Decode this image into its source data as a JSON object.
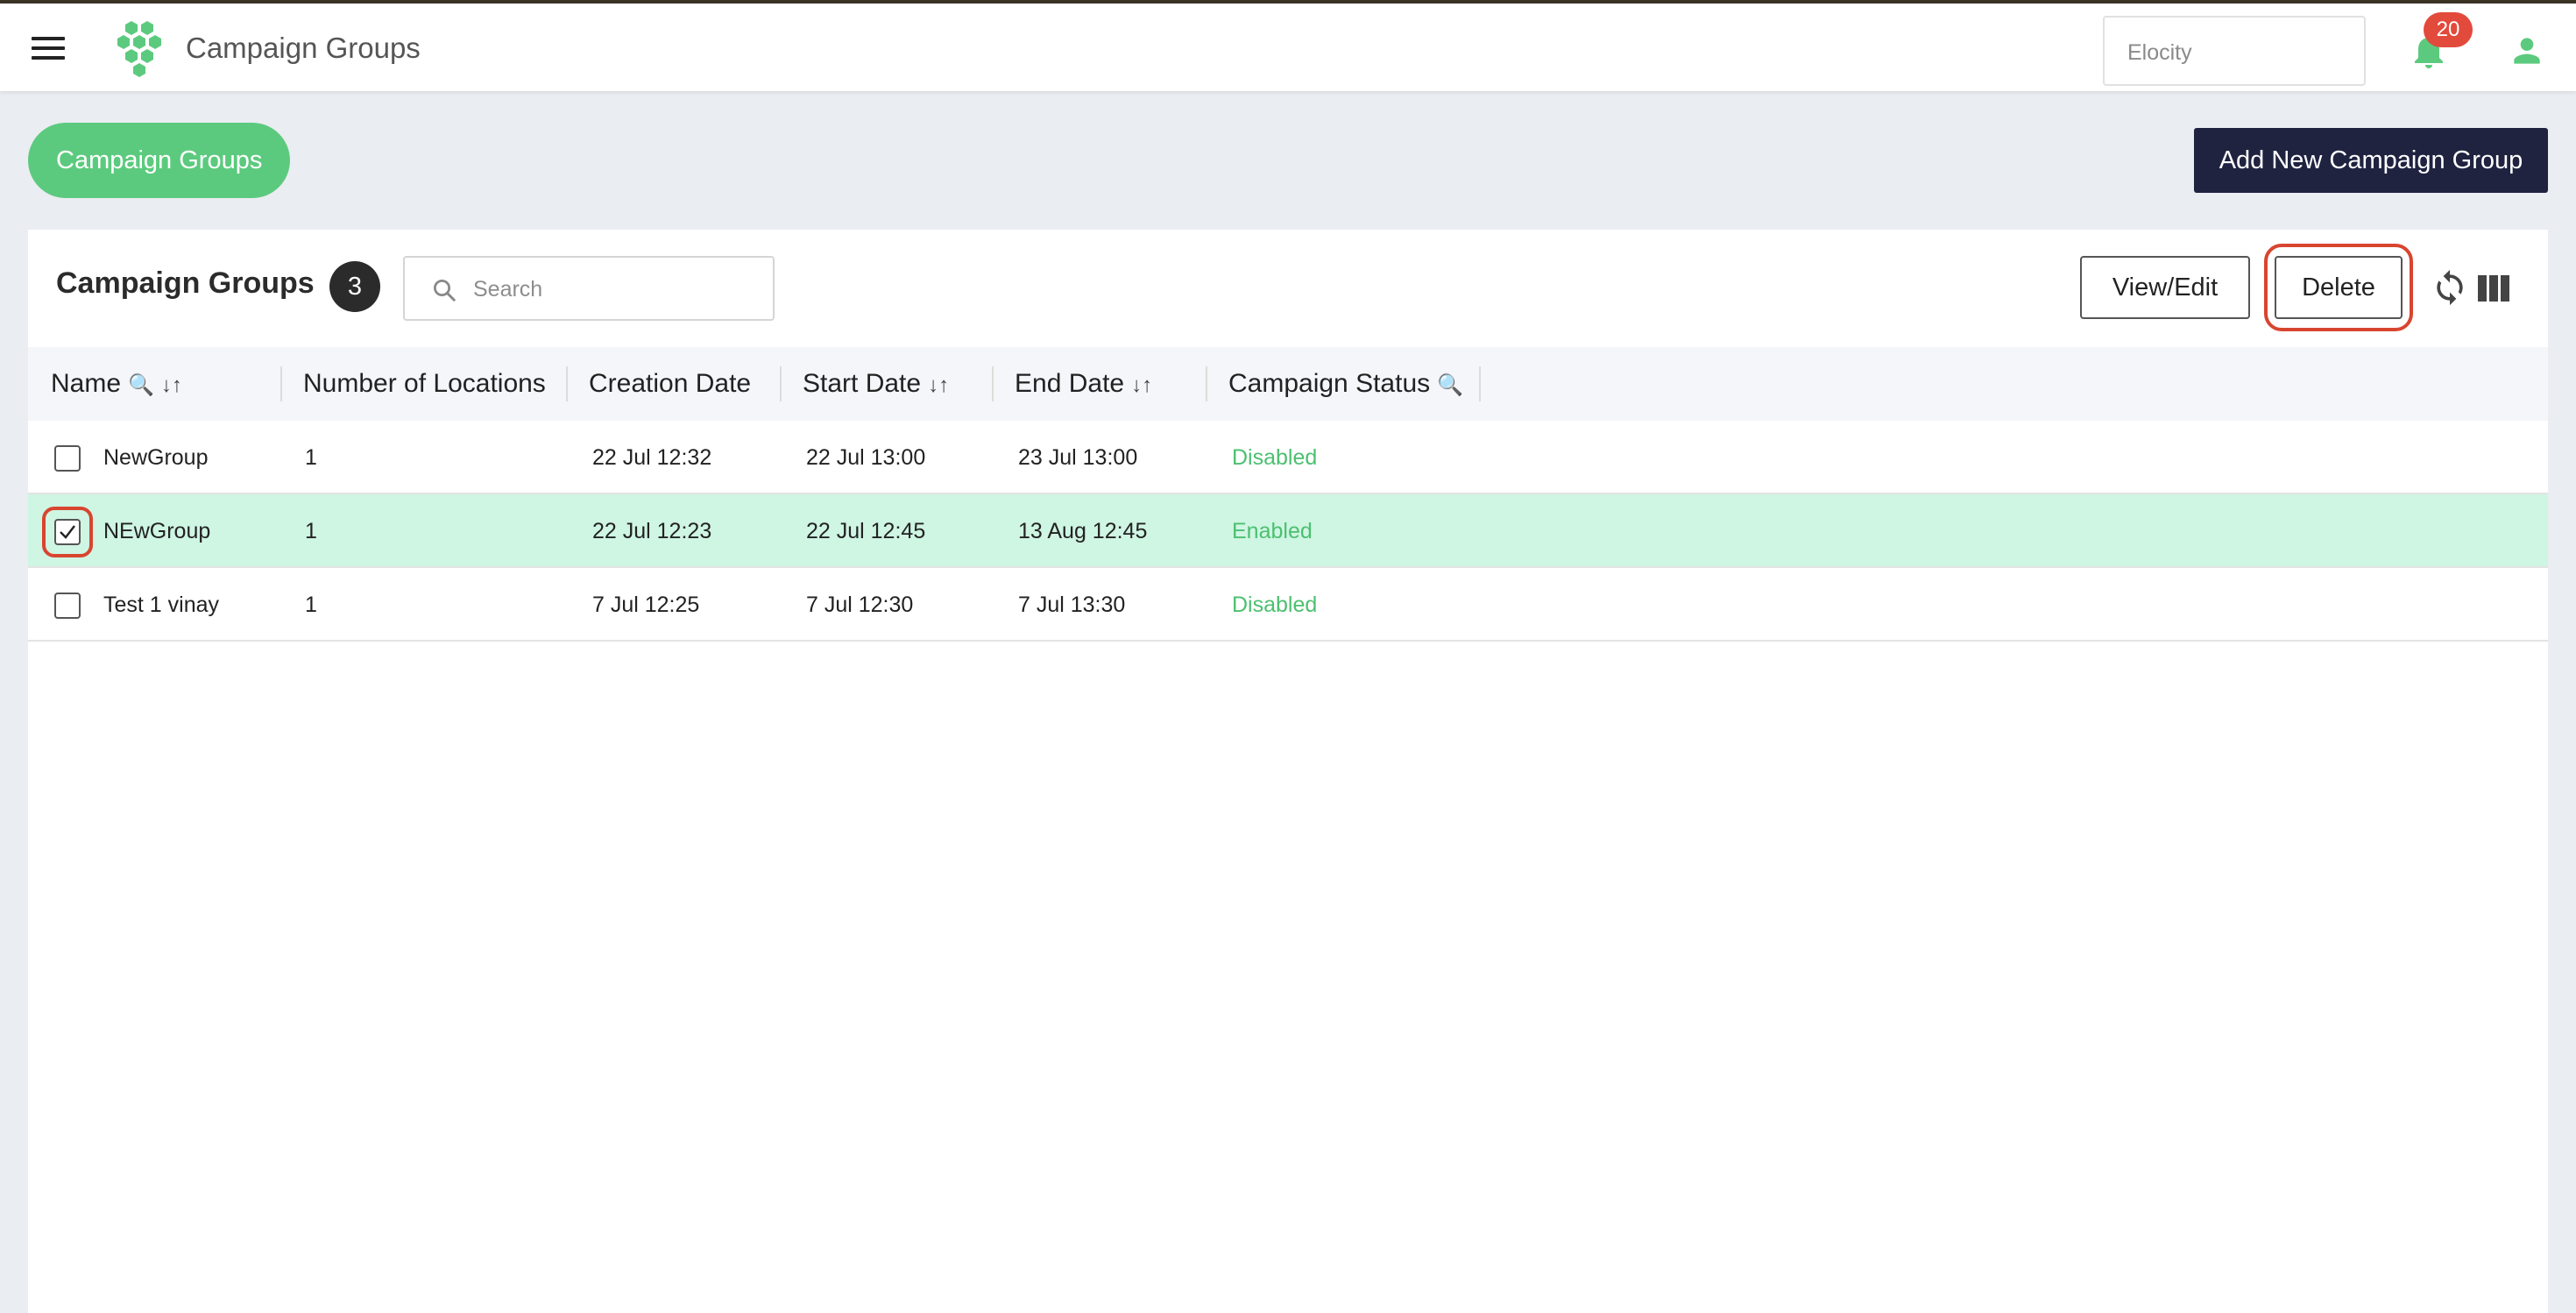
{
  "header": {
    "app_title": "Campaign Groups",
    "tenant_value": "Elocity",
    "notification_count": "20"
  },
  "toolbar": {
    "pill_label": "Campaign Groups",
    "add_label": "Add New Campaign Group"
  },
  "panel": {
    "title": "Campaign Groups",
    "count": "3",
    "search_placeholder": "Search",
    "view_edit_label": "View/Edit",
    "delete_label": "Delete"
  },
  "table": {
    "columns": [
      {
        "label": "Name",
        "icons": "search, sort"
      },
      {
        "label": "Number of Locations"
      },
      {
        "label": "Creation Date"
      },
      {
        "label": "Start Date",
        "icons": "sort"
      },
      {
        "label": "End Date",
        "icons": "sort"
      },
      {
        "label": "Campaign Status",
        "icons": "search"
      }
    ],
    "rows": [
      {
        "name": "NewGroup",
        "locations": "1",
        "created": "22 Jul 12:32",
        "start": "22 Jul 13:00",
        "end": "23 Jul 13:00",
        "status": "Disabled",
        "checked": false
      },
      {
        "name": "NEwGroup",
        "locations": "1",
        "created": "22 Jul 12:23",
        "start": "22 Jul 12:45",
        "end": "13 Aug 12:45",
        "status": "Enabled",
        "checked": true
      },
      {
        "name": "Test 1 vinay",
        "locations": "1",
        "created": "7 Jul 12:25",
        "start": "7 Jul 12:30",
        "end": "7 Jul 13:30",
        "status": "Disabled",
        "checked": false
      }
    ]
  },
  "colors": {
    "accent_green": "#5cca7e",
    "status_green": "#4cc070",
    "primary_dark": "#1f2340",
    "selected_row": "#cff5e3",
    "highlight_red": "#d8452f",
    "badge_red": "#e24a3b"
  },
  "icons": {
    "menu": "hamburger-icon",
    "logo": "hexagon-cluster-logo",
    "notifications": "bell-icon",
    "profile": "user-icon",
    "search": "search-icon",
    "refresh": "refresh-icon",
    "columns": "columns-icon",
    "sort": "sort-arrows-icon",
    "checkmark": "checkmark-icon"
  }
}
